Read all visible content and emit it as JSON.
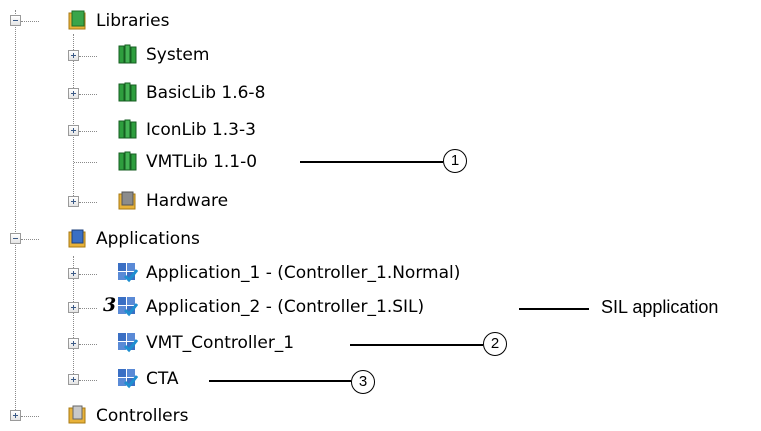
{
  "tree": {
    "libraries": {
      "label": "Libraries",
      "children": [
        "System",
        "BasicLib 1.6-8",
        "IconLib 1.3-3",
        "VMTLib 1.1-0",
        "Hardware"
      ]
    },
    "applications": {
      "label": "Applications",
      "children": [
        "Application_1 - (Controller_1.Normal)",
        "Application_2 - (Controller_1.SIL)",
        "VMT_Controller_1",
        "CTA"
      ],
      "sil_badge": "3"
    },
    "controllers": {
      "label": "Controllers"
    }
  },
  "annotations": {
    "callout_1": "1",
    "callout_2": "2",
    "callout_3": "3",
    "sil_text": "SIL application"
  },
  "colors": {
    "library_green": "#2e9e3e",
    "application_blue": "#3a6fc4",
    "folder_yellow": "#e8b23a"
  }
}
